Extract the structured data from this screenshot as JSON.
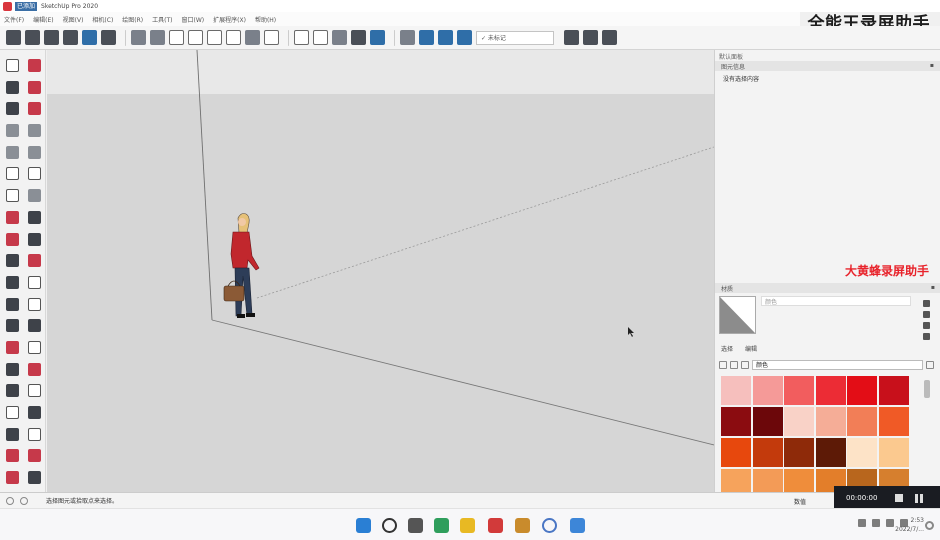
{
  "app": {
    "title_tag": "已添加",
    "title": "SketchUp Pro 2020"
  },
  "menubar": {
    "items": [
      "文件(F)",
      "编辑(E)",
      "视图(V)",
      "相机(C)",
      "绘图(R)",
      "工具(T)",
      "窗口(W)",
      "扩展程序(X)",
      "帮助(H)"
    ]
  },
  "watermarks": {
    "top_right": "全能王录屏助手",
    "middle_right": "大黄蜂录屏助手"
  },
  "toolbar": {
    "layer_select": "✓ 未标记"
  },
  "right_panel": {
    "title": "默认面板",
    "entity_info": {
      "header": "图元信息",
      "text": "没有选择内容"
    },
    "materials": {
      "header": "材质",
      "name_placeholder": "颜色",
      "tabs": [
        "选择",
        "编辑"
      ],
      "library": "颜色",
      "swatches": [
        "#f6bfbd",
        "#f59a98",
        "#f25d5e",
        "#ec2c35",
        "#e30d16",
        "#c8101b",
        "#8b0c10",
        "#6c070a",
        "#f9d2c7",
        "#f5ad97",
        "#f27e57",
        "#f05a26",
        "#e7480d",
        "#c33a0c",
        "#8e2a09",
        "#5d1a06",
        "#fde3c7",
        "#fbc98f",
        "#f6a35c",
        "#f39b57",
        "#ef8d3b",
        "#e37e2a",
        "#b8661d",
        "#d67f2e"
      ]
    }
  },
  "statusbar": {
    "message": "选择图元或拾取点来选择。",
    "right_label": "数值"
  },
  "recording": {
    "time": "00:00:00"
  },
  "taskbar": {
    "clock_time": "2:53",
    "clock_date": "2022/7/..."
  }
}
